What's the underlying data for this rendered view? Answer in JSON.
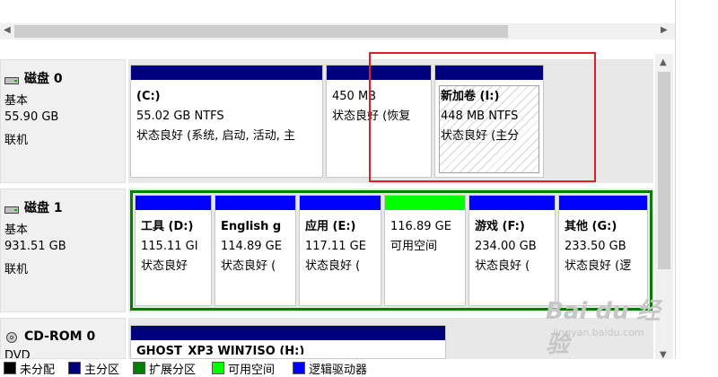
{
  "disks": [
    {
      "name": "磁盘 0",
      "type": "基本",
      "size": "55.90 GB",
      "status": "联机",
      "partitions": [
        {
          "label": "(C:)",
          "size": "55.02 GB NTFS",
          "status": "状态良好 (系统, 启动, 活动, 主"
        },
        {
          "label": "",
          "size": "450 MB",
          "status": "状态良好 (恢复"
        },
        {
          "label": "新加卷  (I:)",
          "size": "448 MB NTFS",
          "status": "状态良好 (主分"
        }
      ]
    },
    {
      "name": "磁盘 1",
      "type": "基本",
      "size": "931.51 GB",
      "status": "联机",
      "partitions": [
        {
          "label": "工具  (D:)",
          "size": "115.11 GI",
          "status": "状态良好"
        },
        {
          "label": "English g",
          "size": "114.89 GE",
          "status": "状态良好 ("
        },
        {
          "label": "应用  (E:)",
          "size": "117.11 GE",
          "status": "状态良好 ("
        },
        {
          "label": "",
          "size": "116.89 GE",
          "status": "可用空间"
        },
        {
          "label": "游戏  (F:)",
          "size": "234.00 GB",
          "status": "状态良好 ("
        },
        {
          "label": "其他  (G:)",
          "size": "233.50 GB",
          "status": "状态良好 (逻"
        }
      ]
    },
    {
      "name": "CD-ROM 0",
      "type": "DVD",
      "partitions": [
        {
          "label": "GHOST_XP3 WIN7ISO  (H:)"
        }
      ]
    }
  ],
  "legend": [
    "未分配",
    "主分区",
    "扩展分区",
    "可用空间",
    "逻辑驱动器"
  ],
  "colors": {
    "primary": "#00007f",
    "logical": "#0000ff",
    "free": "#00ff00",
    "extended": "#008000",
    "unallocated": "#000000",
    "highlight": "#e02020"
  },
  "watermark": {
    "brand": "Bai du 经验",
    "url": "jingyan.baidu.com"
  }
}
